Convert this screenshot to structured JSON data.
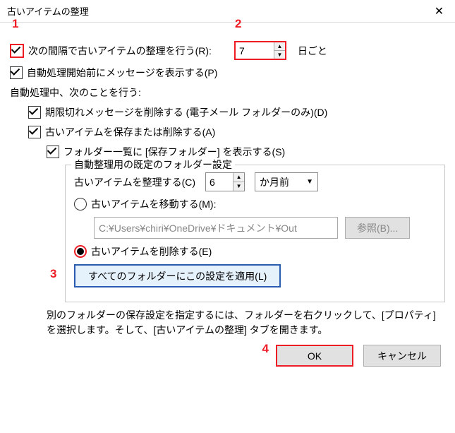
{
  "title": "古いアイテムの整理",
  "annotations": {
    "a1": "1",
    "a2": "2",
    "a3": "3",
    "a4": "4"
  },
  "run": {
    "label": "次の間隔で古いアイテムの整理を行う(R):",
    "interval_value": "7",
    "interval_unit": "日ごと"
  },
  "prompt": {
    "label": "自動処理開始前にメッセージを表示する(P)"
  },
  "during_label": "自動処理中、次のことを行う:",
  "delete_expired": {
    "label": "期限切れメッセージを削除する (電子メール フォルダーのみ)(D)"
  },
  "archive_or_delete": {
    "label": "古いアイテムを保存または削除する(A)"
  },
  "show_folder": {
    "label": "フォルダー一覧に [保存フォルダー] を表示する(S)"
  },
  "group": {
    "legend": "自動整理用の既定のフォルダー設定",
    "clean_label": "古いアイテムを整理する(C)",
    "clean_value": "6",
    "clean_unit": "か月前",
    "move_label": "古いアイテムを移動する(M):",
    "path": "C:¥Users¥chiri¥OneDrive¥ドキュメント¥Out",
    "browse": "参照(B)...",
    "delete_label": "古いアイテムを削除する(E)",
    "apply_all": "すべてのフォルダーにこの設定を適用(L)"
  },
  "info": "別のフォルダーの保存設定を指定するには、フォルダーを右クリックして、[プロパティ] を選択します。そして、[古いアイテムの整理] タブを開きます。",
  "buttons": {
    "ok": "OK",
    "cancel": "キャンセル"
  }
}
